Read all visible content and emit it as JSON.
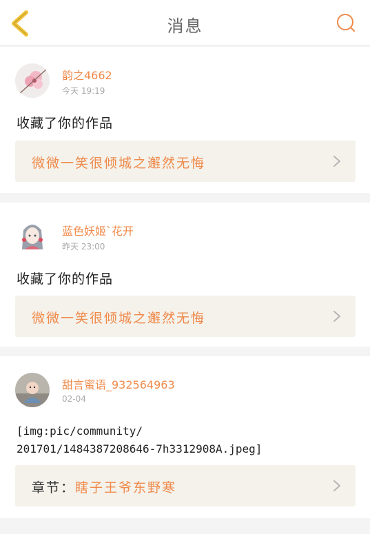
{
  "header": {
    "title": "消息"
  },
  "messages": [
    {
      "username": "韵之4662",
      "time": "今天 19:19",
      "text": "收藏了你的作品",
      "link": "微微一笑很倾城之邂然无悔"
    },
    {
      "username": "蓝色妖姬`花开",
      "time": "昨天 23:00",
      "text": "收藏了你的作品",
      "link": "微微一笑很倾城之邂然无悔"
    },
    {
      "username": "甜言蜜语_932564963",
      "time": "02-04",
      "text_line1": "[img:pic/community/",
      "text_line2": "201701/1484387208646-7h3312908A.jpeg]",
      "link_prefix": "章节：",
      "link": "瞎子王爷东野寒"
    }
  ],
  "colors": {
    "accent": "#f08a4b",
    "back_icon": "#f0c23a",
    "link_bg": "#f4f2eb"
  },
  "icons": {
    "back": "chevron-left-icon",
    "search": "search-icon",
    "row_arrow": "chevron-right-icon"
  }
}
